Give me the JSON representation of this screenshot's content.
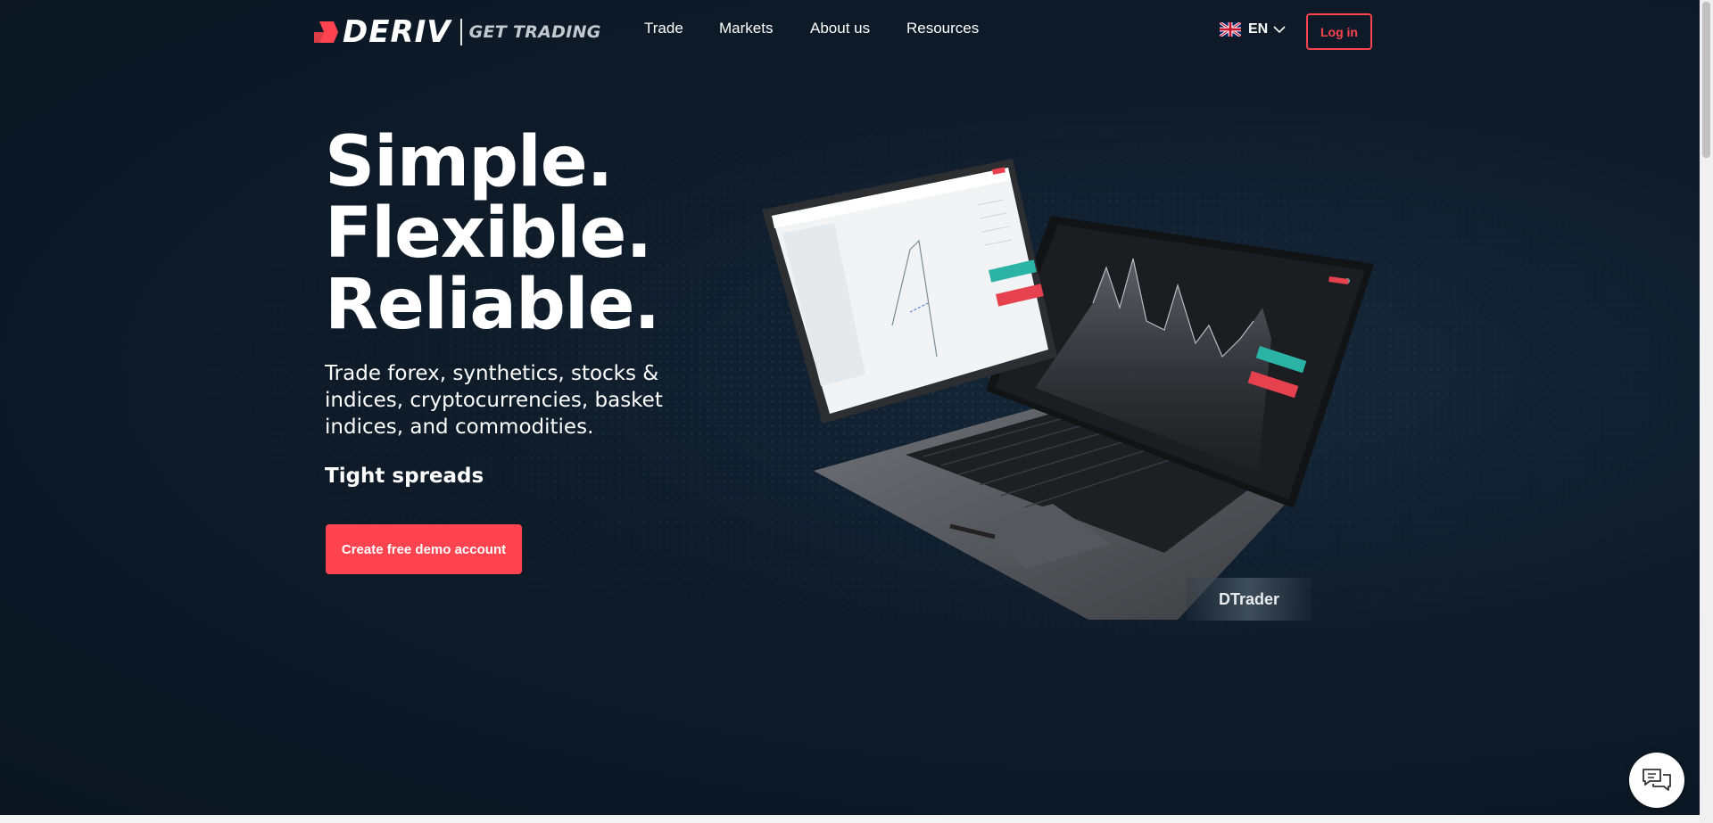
{
  "header": {
    "logo_word": "DERIV",
    "logo_tagline": "GET TRADING",
    "nav": [
      "Trade",
      "Markets",
      "About us",
      "Resources"
    ],
    "language": {
      "code": "EN",
      "flag_icon": "uk-flag-icon"
    },
    "login_label": "Log in"
  },
  "hero": {
    "headline": [
      "Simple.",
      "Flexible.",
      "Reliable."
    ],
    "subtitle": "Trade forex, synthetics, stocks & indices, cryptocurrencies, basket indices, and commodities.",
    "tagline": "Tight spreads",
    "cta_label": "Create free demo account",
    "platform_label": "DTrader"
  },
  "chat": {
    "icon": "chat-bubbles-icon"
  },
  "colors": {
    "brand_red": "#ff444f",
    "background": "#0e1b29",
    "text": "#ffffff"
  }
}
